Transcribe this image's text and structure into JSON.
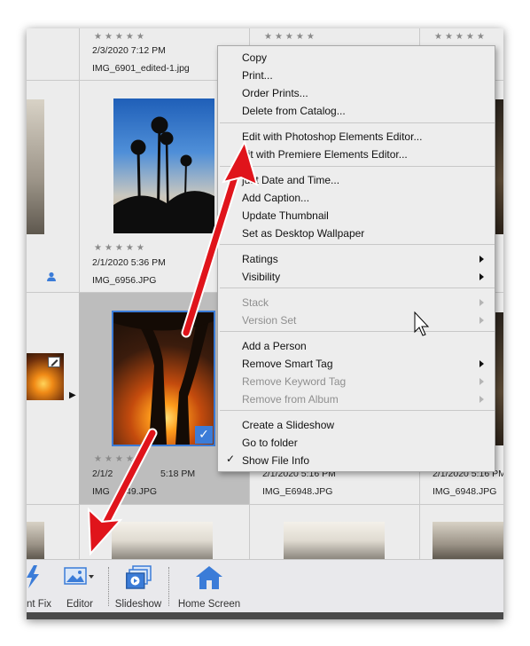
{
  "grid": {
    "row1": {
      "stars": "★★★★★",
      "col2": {
        "date": "2/3/2020 7:12 PM",
        "name": "IMG_6901_edited-1.jpg"
      },
      "col3": {
        "stars": "★★★★★"
      },
      "col4": {
        "stars": "★★★★★"
      }
    },
    "row2": {
      "col2": {
        "stars": "★★★★★",
        "date": "2/1/2020 5:36 PM",
        "name": "IMG_6956.JPG"
      }
    },
    "row3": {
      "col2": {
        "stars": "★★★★★",
        "date": "2/1/2020 5:18 PM",
        "name": "IMG_6949.JPG",
        "date_visible": "2/1/2",
        "date_tail": "5:18 PM",
        "name_head": "IMG",
        "name_tail": "49.JPG"
      },
      "col3": {
        "date_visible": "2/1/2020 5:16 PM",
        "name": "IMG_E6948.JPG"
      },
      "col4": {
        "date_visible": "2/1/2020 5:16 PM",
        "name": "IMG_6948.JPG"
      }
    }
  },
  "context_menu": {
    "items": [
      {
        "label": "Copy",
        "enabled": true
      },
      {
        "label": "Print...",
        "enabled": true
      },
      {
        "label": "Order Prints...",
        "enabled": true
      },
      {
        "label": "Delete from Catalog...",
        "enabled": true
      },
      {
        "label": "Edit with Photoshop Elements Editor...",
        "enabled": true
      },
      {
        "label": "Edit with Premiere Elements Editor...",
        "enabled": true,
        "visible": "dit with Premiere Elements Editor..."
      },
      {
        "label": "Adjust Date and Time...",
        "enabled": true,
        "visible": "just Date and Time..."
      },
      {
        "label": "Add Caption...",
        "enabled": true
      },
      {
        "label": "Update Thumbnail",
        "enabled": true
      },
      {
        "label": "Set as Desktop Wallpaper",
        "enabled": true
      },
      {
        "label": "Ratings",
        "enabled": true,
        "submenu": true
      },
      {
        "label": "Visibility",
        "enabled": true,
        "submenu": true
      },
      {
        "label": "Stack",
        "enabled": false,
        "submenu": true
      },
      {
        "label": "Version Set",
        "enabled": false,
        "submenu": true
      },
      {
        "label": "Add a Person",
        "enabled": true
      },
      {
        "label": "Remove Smart Tag",
        "enabled": true,
        "submenu": true
      },
      {
        "label": "Remove Keyword Tag",
        "enabled": false,
        "submenu": true
      },
      {
        "label": "Remove from Album",
        "enabled": false,
        "submenu": true
      },
      {
        "label": "Create a Slideshow",
        "enabled": true
      },
      {
        "label": "Go to folder",
        "enabled": true
      },
      {
        "label": "Show File Info",
        "enabled": true,
        "checked": true
      }
    ]
  },
  "toolbar": {
    "instant_fix_label": "nt Fix",
    "editor_label": "Editor",
    "slideshow_label": "Slideshow",
    "home_label": "Home Screen"
  },
  "colors": {
    "annotation_arrow": "#e0141b",
    "selection": "#3b7cd8",
    "menu_bg": "#ededed"
  },
  "icons": {
    "person": "person-icon",
    "edit_badge": "edit-badge-icon",
    "checkmark": "checkmark-icon",
    "cursor": "mouse-pointer-icon"
  }
}
